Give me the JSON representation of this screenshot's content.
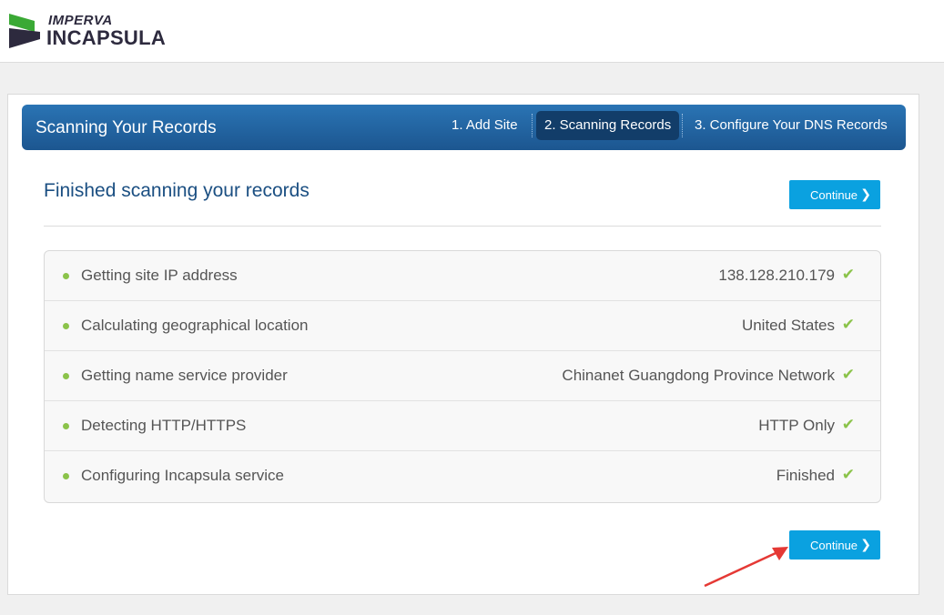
{
  "brand": {
    "line1": "IMPERVA",
    "line2": "INCAPSULA"
  },
  "wizard": {
    "title": "Scanning Your Records",
    "steps": [
      {
        "label": "1. Add Site"
      },
      {
        "label": "2. Scanning Records",
        "active": true
      },
      {
        "label": "3. Configure Your DNS Records"
      }
    ]
  },
  "main": {
    "heading": "Finished scanning your records",
    "continue_label": "Continue",
    "records": [
      {
        "label": "Getting site IP address",
        "value": "138.128.210.179"
      },
      {
        "label": "Calculating geographical location",
        "value": "United States"
      },
      {
        "label": "Getting name service provider",
        "value": "Chinanet Guangdong Province Network"
      },
      {
        "label": "Detecting HTTP/HTTPS",
        "value": "HTTP Only"
      },
      {
        "label": "Configuring Incapsula service",
        "value": "Finished"
      }
    ]
  },
  "colors": {
    "header": "#1c5690",
    "button": "#0aa1e0",
    "check": "#8bc34a",
    "annotation_arrow": "#e53935"
  },
  "icons": {
    "step_chevron": "chevron-right-icon",
    "status": "check-icon",
    "bullet": "bullet-dot-icon"
  }
}
